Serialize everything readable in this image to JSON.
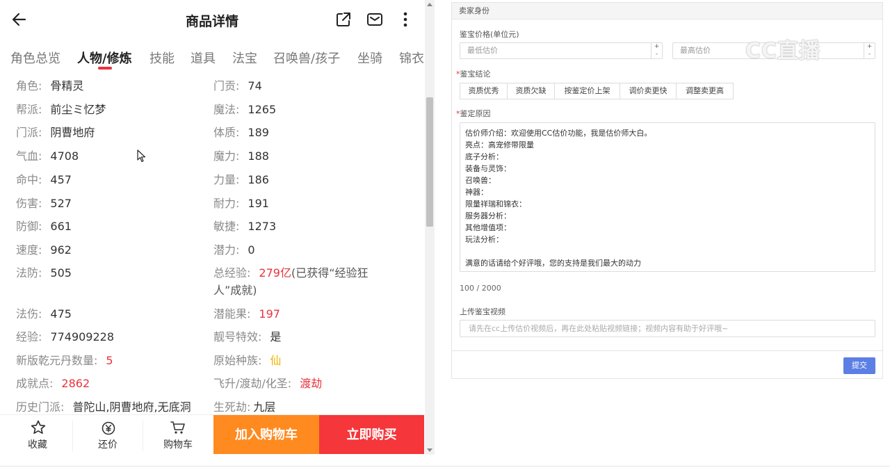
{
  "header": {
    "title": "商品详情"
  },
  "tabs": [
    {
      "label": "角色总览"
    },
    {
      "label": "人物/修炼"
    },
    {
      "label": "技能"
    },
    {
      "label": "道具"
    },
    {
      "label": "法宝"
    },
    {
      "label": "召唤兽/孩子"
    },
    {
      "label": "坐骑"
    },
    {
      "label": "锦衣"
    }
  ],
  "attrs_left": [
    {
      "key": "角色:",
      "value": "骨精灵"
    },
    {
      "key": "帮派:",
      "value": "前尘ミ忆梦"
    },
    {
      "key": "门派:",
      "value": "阴曹地府"
    },
    {
      "key": "气血:",
      "value": "4708"
    },
    {
      "key": "命中:",
      "value": "457"
    },
    {
      "key": "伤害:",
      "value": "527"
    },
    {
      "key": "防御:",
      "value": "661"
    },
    {
      "key": "速度:",
      "value": "962"
    },
    {
      "key": "法防:",
      "value": "505"
    },
    {
      "key": "法伤:",
      "value": "475"
    },
    {
      "key": "经验:",
      "value": "774909228"
    },
    {
      "key": "新版乾元丹数量:",
      "value": "5"
    },
    {
      "key": "成就点:",
      "value": "2862"
    },
    {
      "key": "历史门派:",
      "value": "普陀山,阴曹地府,无底洞"
    }
  ],
  "attrs_right": [
    {
      "key": "门贡:",
      "value": "74"
    },
    {
      "key": "魔法:",
      "value": "1265"
    },
    {
      "key": "体质:",
      "value": "189"
    },
    {
      "key": "魔力:",
      "value": "188"
    },
    {
      "key": "力量:",
      "value": "186"
    },
    {
      "key": "耐力:",
      "value": "191"
    },
    {
      "key": "敏捷:",
      "value": "1273"
    },
    {
      "key": "潜力:",
      "value": "0"
    },
    {
      "key": "总经验:",
      "value": "279亿",
      "note": "(已获得“经验狂",
      "note2": "人”成就)"
    },
    {
      "key": "潜能果:",
      "value": "197"
    },
    {
      "key": "靓号特效:",
      "value": "是"
    },
    {
      "key": "原始种族:",
      "value": "仙"
    },
    {
      "key": "飞升/渡劫/化圣:",
      "value": "渡劫"
    },
    {
      "key": "生死劫:",
      "value": "九层"
    }
  ],
  "bottom_bar": {
    "favorite": "收藏",
    "bargain": "还价",
    "cart": "购物车",
    "add_to_cart": "加入购物车",
    "buy_now": "立即购买"
  },
  "form": {
    "panel_title": "卖家身份",
    "price_label": "鉴宝价格(单位元)",
    "min_placeholder": "最低估价",
    "max_placeholder": "最高估价",
    "conclusion_label": "鉴宝结论",
    "conclusions": [
      "资质优秀",
      "资质欠缺",
      "按鉴定价上架",
      "调价卖更快",
      "调整卖更高"
    ],
    "reason_label": "鉴定原因",
    "reason_text": "估价师介绍：欢迎使用CC估价功能，我是估价师大白。\n亮点：高宠修带限量\n底子分析：\n装备与灵饰：\n召唤兽：\n神器：\n限量祥瑞和锦衣：\n服务器分析：\n其他增值项：\n玩法分析：\n\n满意的话请给个好评哦，您的支持是我们最大的动力",
    "counter": "100 / 2000",
    "video_label": "上传鉴宝视频",
    "video_placeholder": "请先在cc上传估价视频后，再在此处粘贴视频链接；视频内容有助于好评哦~",
    "submit": "提交"
  },
  "watermark": "CC直播",
  "colors": {
    "accent_red": "#e8323c",
    "cart_orange": "#ff8a1f",
    "buy_red": "#f5363a",
    "submit_blue": "#5b7fe4",
    "gold": "#f0b400"
  }
}
